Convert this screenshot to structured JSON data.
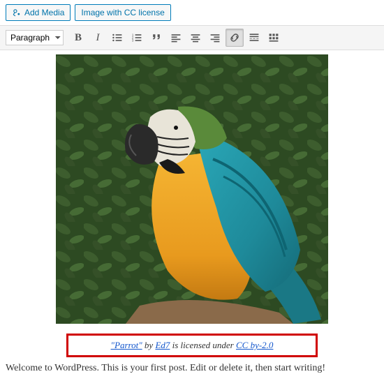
{
  "topButtons": {
    "addMedia": "Add Media",
    "ccLicense": "Image with CC license"
  },
  "toolbar": {
    "formatSelected": "Paragraph"
  },
  "caption": {
    "titleLink": "\"Parrot\"",
    "byText": " by ",
    "authorLink": "Ed7",
    "licensedText": " is licensed under ",
    "licenseLink": "CC by-2.0"
  },
  "bodyText": "Welcome to WordPress. This is your first post. Edit or delete it, then start writing!"
}
